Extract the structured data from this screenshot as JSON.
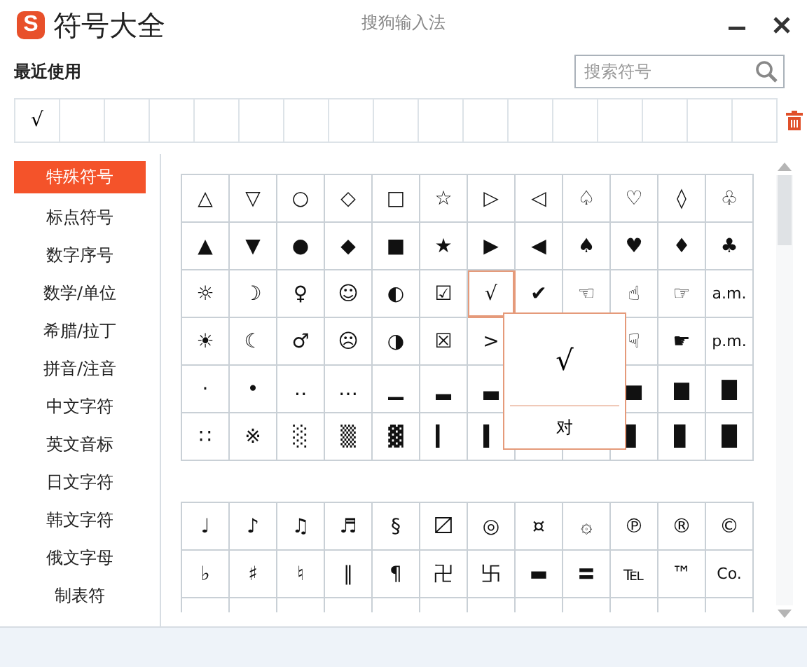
{
  "window": {
    "logo": "S",
    "title": "符号大全",
    "app_name": "搜狗输入法"
  },
  "recent": {
    "label": "最近使用",
    "symbols": [
      "√"
    ]
  },
  "search": {
    "placeholder": "搜索符号"
  },
  "sidebar": {
    "items": [
      {
        "label": "特殊符号",
        "selected": true
      },
      {
        "label": "标点符号",
        "selected": false
      },
      {
        "label": "数字序号",
        "selected": false
      },
      {
        "label": "数学/单位",
        "selected": false
      },
      {
        "label": "希腊/拉丁",
        "selected": false
      },
      {
        "label": "拼音/注音",
        "selected": false
      },
      {
        "label": "中文字符",
        "selected": false
      },
      {
        "label": "英文音标",
        "selected": false
      },
      {
        "label": "日文字符",
        "selected": false
      },
      {
        "label": "韩文字符",
        "selected": false
      },
      {
        "label": "俄文字母",
        "selected": false
      },
      {
        "label": "制表符",
        "selected": false
      }
    ]
  },
  "symbol_grid": {
    "rows": [
      [
        {
          "symbol": "△",
          "hovered": false
        },
        {
          "symbol": "▽",
          "hovered": false
        },
        {
          "symbol": "○",
          "hovered": false
        },
        {
          "symbol": "◇",
          "hovered": false
        },
        {
          "symbol": "□",
          "hovered": false
        },
        {
          "symbol": "☆",
          "hovered": false
        },
        {
          "symbol": "▷",
          "hovered": false
        },
        {
          "symbol": "◁",
          "hovered": false
        },
        {
          "symbol": "♤",
          "hovered": false
        },
        {
          "symbol": "♡",
          "hovered": false
        },
        {
          "symbol": "◊",
          "hovered": false
        },
        {
          "symbol": "♧",
          "hovered": false
        }
      ],
      [
        {
          "symbol": "▲",
          "hovered": false
        },
        {
          "symbol": "▼",
          "hovered": false
        },
        {
          "symbol": "●",
          "hovered": false
        },
        {
          "symbol": "◆",
          "hovered": false
        },
        {
          "symbol": "■",
          "hovered": false
        },
        {
          "symbol": "★",
          "hovered": false
        },
        {
          "symbol": "▶",
          "hovered": false
        },
        {
          "symbol": "◀",
          "hovered": false
        },
        {
          "symbol": "♠",
          "hovered": false
        },
        {
          "symbol": "♥",
          "hovered": false
        },
        {
          "symbol": "♦",
          "hovered": false
        },
        {
          "symbol": "♣",
          "hovered": false
        }
      ],
      [
        {
          "symbol": "☼",
          "hovered": false
        },
        {
          "symbol": "☽",
          "hovered": false
        },
        {
          "symbol": "♀",
          "hovered": false
        },
        {
          "symbol": "☺",
          "hovered": false
        },
        {
          "symbol": "◐",
          "hovered": false
        },
        {
          "symbol": "☑",
          "hovered": false
        },
        {
          "symbol": "√",
          "hovered": true
        },
        {
          "symbol": "✔",
          "hovered": false
        },
        {
          "symbol": "☜",
          "hovered": false
        },
        {
          "symbol": "☝",
          "hovered": false
        },
        {
          "symbol": "☞",
          "hovered": false
        },
        {
          "symbol": "a.m.",
          "hovered": false
        }
      ],
      [
        {
          "symbol": "☀",
          "hovered": false
        },
        {
          "symbol": "☾",
          "hovered": false
        },
        {
          "symbol": "♂",
          "hovered": false
        },
        {
          "symbol": "☹",
          "hovered": false
        },
        {
          "symbol": "◑",
          "hovered": false
        },
        {
          "symbol": "☒",
          "hovered": false
        },
        {
          "symbol": ">",
          "hovered": false
        },
        null,
        null,
        {
          "symbol": "☟",
          "hovered": false
        },
        {
          "symbol": "☛",
          "hovered": false
        },
        {
          "symbol": "p.m.",
          "hovered": false
        }
      ],
      [
        {
          "symbol": "·",
          "hovered": false
        },
        {
          "symbol": "•",
          "hovered": false
        },
        {
          "symbol": "‥",
          "hovered": false
        },
        {
          "symbol": "…",
          "hovered": false
        },
        {
          "symbol": "▁",
          "hovered": false
        },
        {
          "symbol": "▂",
          "hovered": false
        },
        {
          "symbol": "▃",
          "hovered": false
        },
        null,
        null,
        {
          "symbol": "▅",
          "hovered": false
        },
        {
          "symbol": "▆",
          "hovered": false
        },
        {
          "symbol": "▇",
          "hovered": false
        }
      ],
      [
        {
          "symbol": "∷",
          "hovered": false
        },
        {
          "symbol": "※",
          "hovered": false
        },
        {
          "symbol": "░",
          "hovered": false
        },
        {
          "symbol": "▒",
          "hovered": false
        },
        {
          "symbol": "▓",
          "hovered": false
        },
        {
          "symbol": "▎",
          "hovered": false
        },
        {
          "symbol": "▍",
          "hovered": false
        },
        null,
        null,
        {
          "symbol": "▋",
          "hovered": false
        },
        {
          "symbol": "▊",
          "hovered": false
        },
        {
          "symbol": "█",
          "hovered": false
        }
      ]
    ],
    "tooltip": {
      "symbol": "√",
      "meaning": "对"
    }
  },
  "symbol_grid_2": {
    "rows": [
      [
        "♩",
        "♪",
        "♫",
        "♬",
        "§",
        "〼",
        "◎",
        "¤",
        "۞",
        "℗",
        "®",
        "©"
      ],
      [
        "♭",
        "♯",
        "♮",
        "‖",
        "¶",
        "卍",
        "卐",
        "▬",
        "〓",
        "℡",
        "™",
        "Co."
      ]
    ]
  }
}
